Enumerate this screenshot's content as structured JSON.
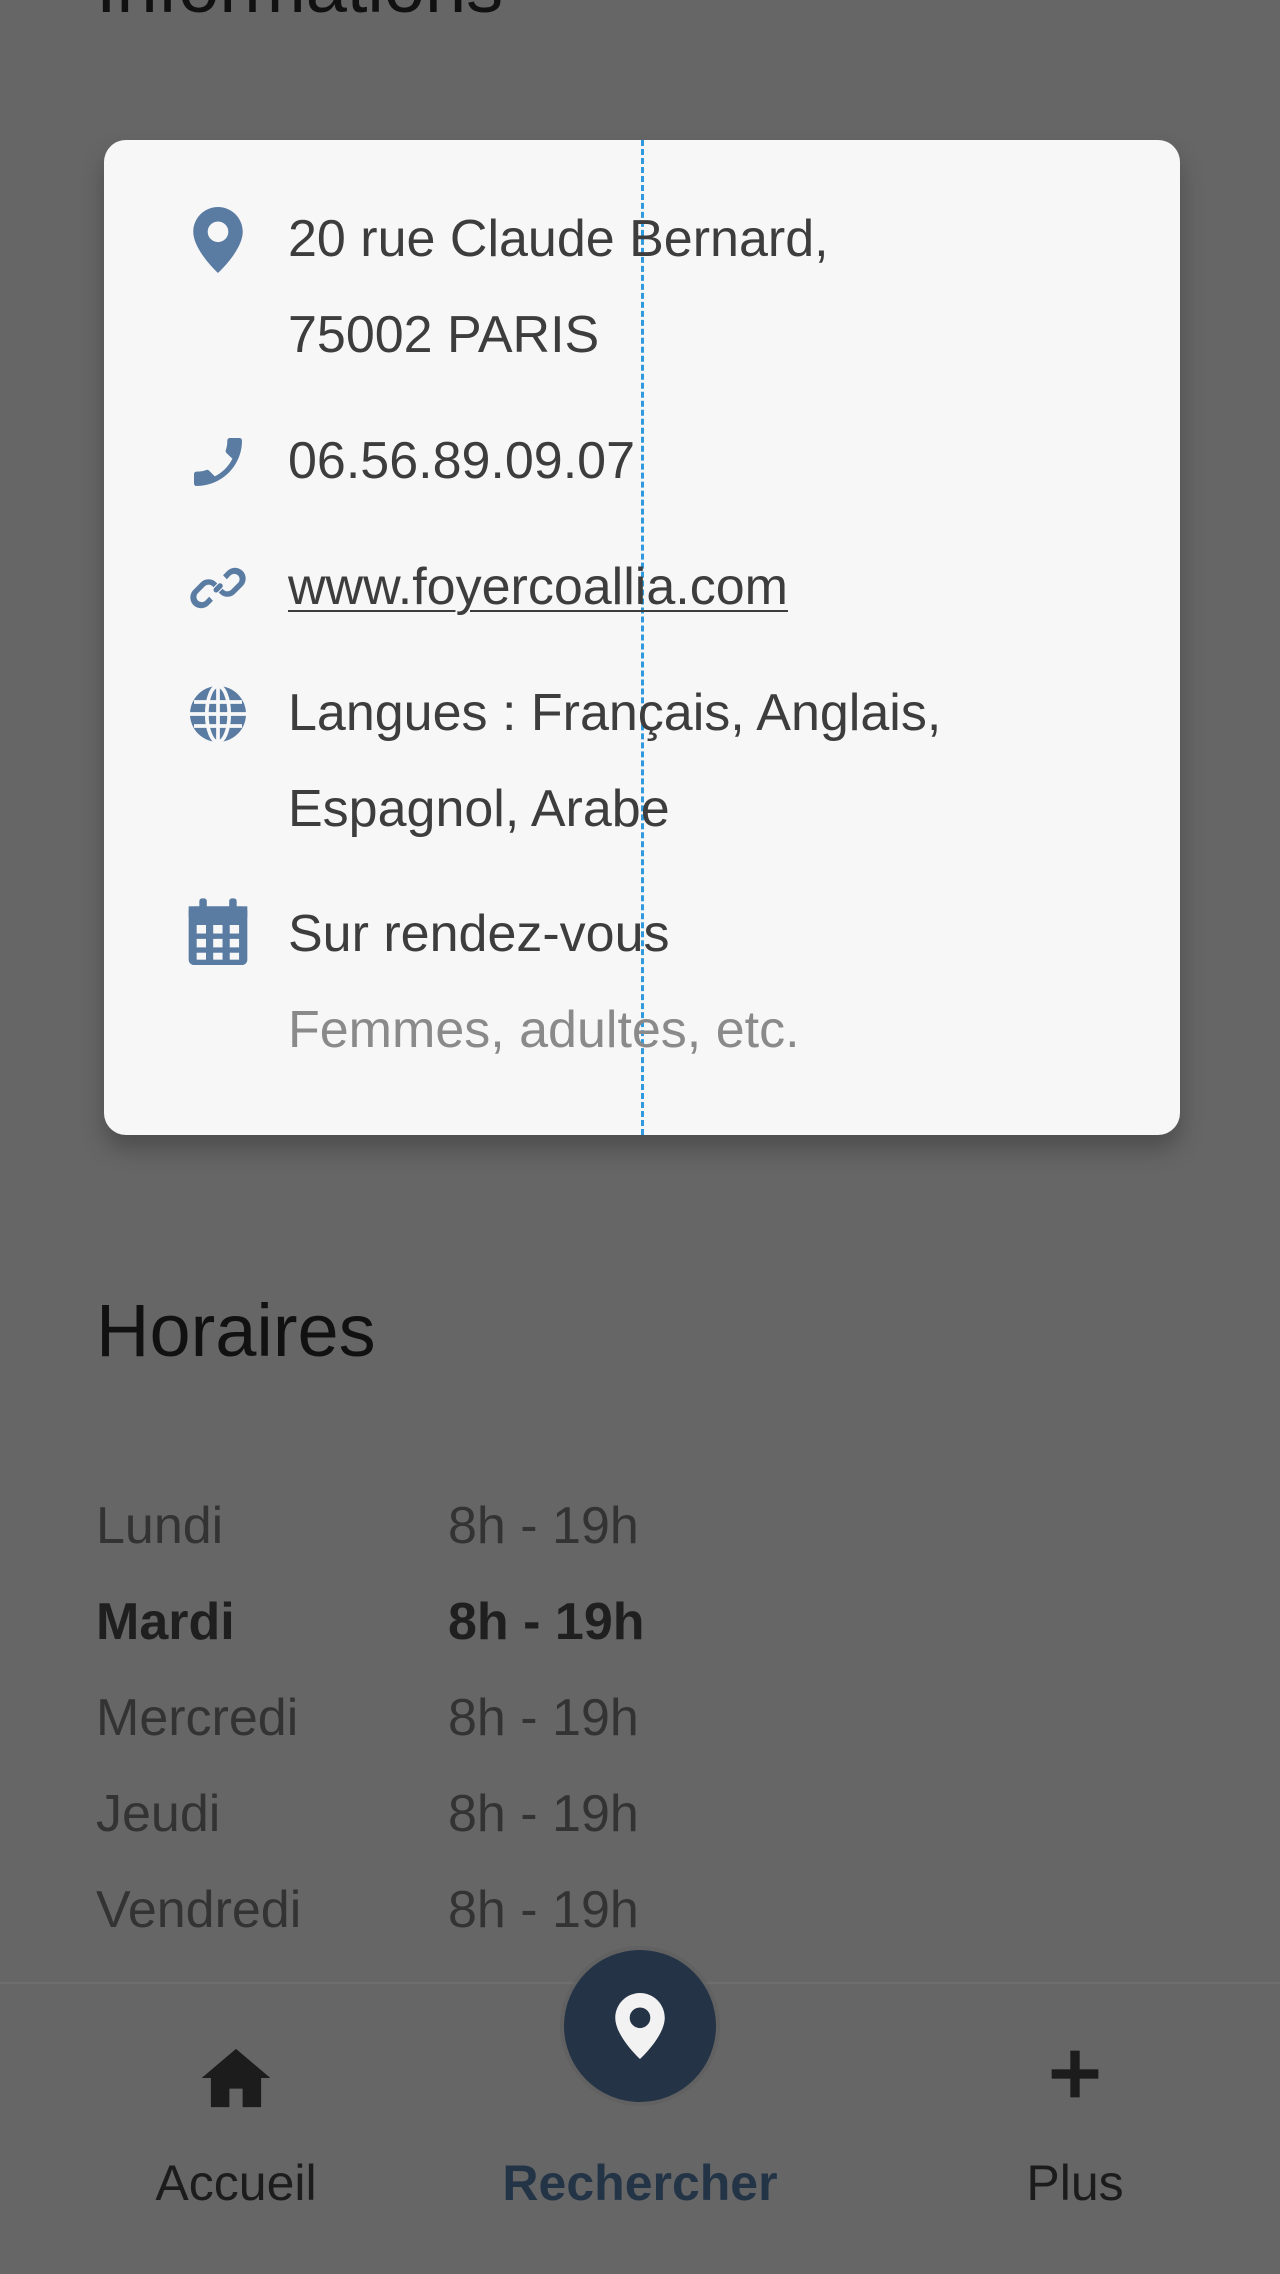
{
  "sections": {
    "informations_title": "Informations",
    "horaires_title": "Horaires"
  },
  "info": {
    "address_line1": "20 rue Claude Bernard,",
    "address_line2": "75002 PARIS",
    "phone": "06.56.89.09.07",
    "website": "www.foyercoallia.com",
    "languages_line1": "Langues : Français, Anglais,",
    "languages_line2": "Espagnol, Arabe",
    "appointment": "Sur rendez-vous",
    "audience": "Femmes, adultes, etc.",
    "icons": [
      "map-marker-icon",
      "phone-icon",
      "link-icon",
      "globe-icon",
      "calendar-icon"
    ],
    "icon_color": "#5a7ca3"
  },
  "hours": [
    {
      "day": "Lundi",
      "time": "8h - 19h",
      "current": false
    },
    {
      "day": "Mardi",
      "time": "8h - 19h",
      "current": true
    },
    {
      "day": "Mercredi",
      "time": "8h - 19h",
      "current": false
    },
    {
      "day": "Jeudi",
      "time": "8h - 19h",
      "current": false
    },
    {
      "day": "Vendredi",
      "time": "8h - 19h",
      "current": false
    }
  ],
  "nav": {
    "home_label": "Accueil",
    "search_label": "Rechercher",
    "more_label": "Plus",
    "icons": [
      "home-icon",
      "map-marker-icon",
      "plus-icon"
    ],
    "active": "Rechercher",
    "active_color": "#253346"
  }
}
